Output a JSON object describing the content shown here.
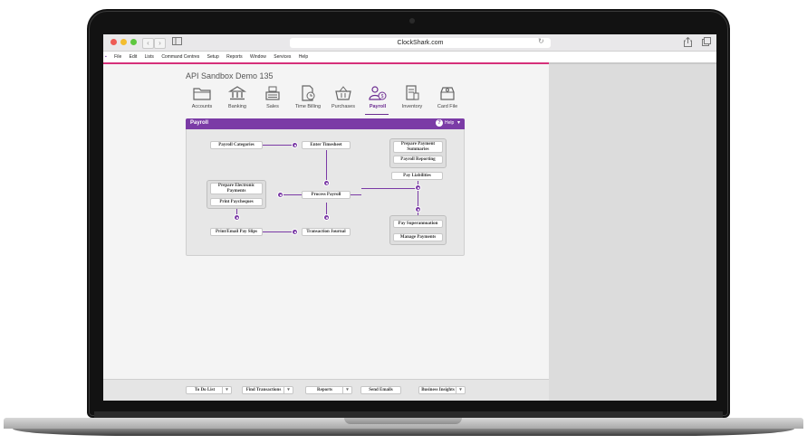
{
  "browser": {
    "url": "ClockShark.com",
    "back": "‹",
    "forward": "›",
    "reload": "↻",
    "sidebar_icon": "sidebar-icon",
    "share_icon": "share-icon",
    "tabs_icon": "tabs-icon"
  },
  "menu": {
    "app_icon": "▪",
    "items": [
      "File",
      "Edit",
      "Lists",
      "Command Centres",
      "Setup",
      "Reports",
      "Window",
      "Services",
      "Help"
    ]
  },
  "company": "API Sandbox Demo 135",
  "nav": [
    {
      "label": "Accounts",
      "icon": "folder-icon"
    },
    {
      "label": "Banking",
      "icon": "bank-icon"
    },
    {
      "label": "Sales",
      "icon": "register-icon"
    },
    {
      "label": "Time Billing",
      "icon": "timesheet-icon"
    },
    {
      "label": "Purchases",
      "icon": "basket-icon"
    },
    {
      "label": "Payroll",
      "icon": "payroll-icon"
    },
    {
      "label": "Inventory",
      "icon": "inventory-icon"
    },
    {
      "label": "Card File",
      "icon": "cardfile-icon"
    }
  ],
  "active_nav": "Payroll",
  "panel": {
    "title": "Payroll",
    "help_label": "Help",
    "help_icon": "?",
    "caret": "▾"
  },
  "flow": {
    "payroll_categories": "Payroll Categories",
    "enter_timesheet": "Enter Timesheet",
    "prepare_payment_summaries": "Prepare Payment Summaries",
    "payroll_reporting": "Payroll Reporting",
    "pay_liabilities": "Pay Liabilities",
    "prepare_electronic_payments": "Prepare Electronic Payments",
    "print_paycheques": "Print Paycheques",
    "process_payroll": "Process Payroll",
    "pay_superannuation": "Pay Superannuation",
    "manage_payments": "Manage Payments",
    "print_email_pay_slips": "Print/Email Pay Slips",
    "transaction_journal": "Transaction Journal"
  },
  "bottom": {
    "todo": "To Do List",
    "find": "Find Transactions",
    "reports": "Reports",
    "send_emails": "Send Emails",
    "insights": "Business Insights",
    "dropdown": "▾"
  },
  "colors": {
    "accent": "#7b3ba6",
    "app_line": "#d6307a"
  }
}
